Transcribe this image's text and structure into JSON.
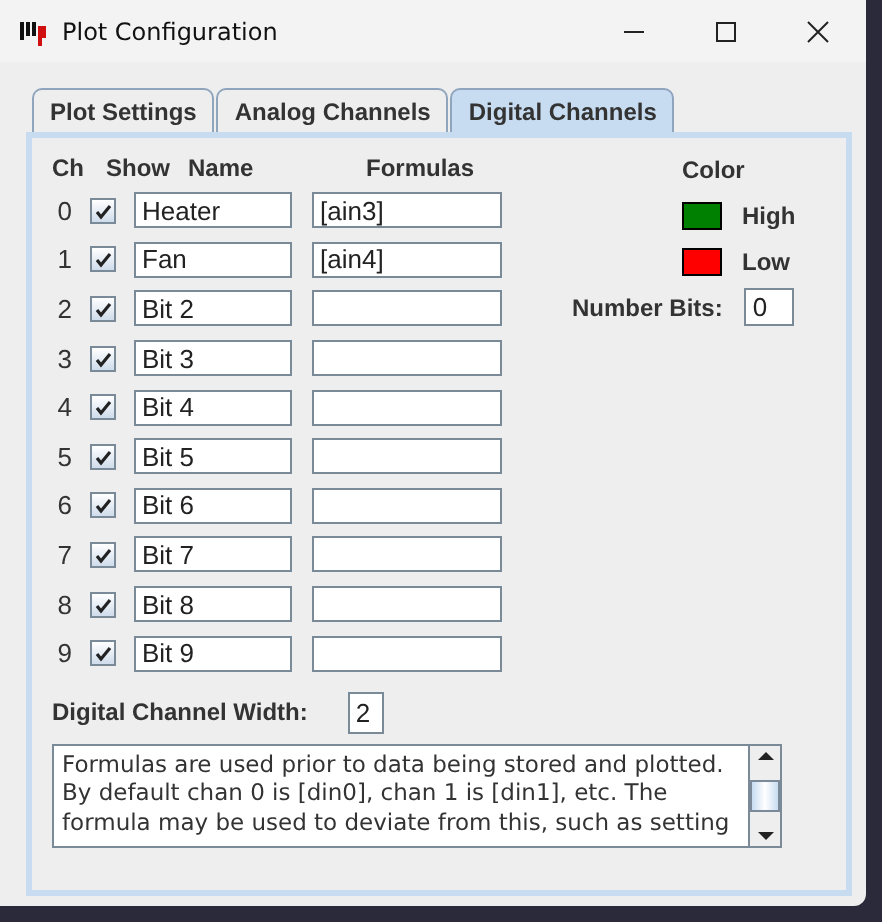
{
  "window": {
    "title": "Plot Configuration"
  },
  "tabs": [
    {
      "label": "Plot Settings",
      "selected": false
    },
    {
      "label": "Analog Channels",
      "selected": false
    },
    {
      "label": "Digital Channels",
      "selected": true
    }
  ],
  "columns": [
    "Ch",
    "Show",
    "Name",
    "Formulas"
  ],
  "channels": [
    {
      "ch": "0",
      "show": true,
      "name": "Heater",
      "formula": "[ain3]"
    },
    {
      "ch": "1",
      "show": true,
      "name": "Fan",
      "formula": "[ain4]"
    },
    {
      "ch": "2",
      "show": true,
      "name": "Bit 2"
    },
    {
      "ch": "3",
      "show": true,
      "name": "Bit 3"
    },
    {
      "ch": "4",
      "show": true,
      "name": "Bit 4"
    },
    {
      "ch": "5",
      "show": true,
      "name": "Bit 5"
    },
    {
      "ch": "6",
      "show": true,
      "name": "Bit 6"
    },
    {
      "ch": "7",
      "show": true,
      "name": "Bit 7"
    },
    {
      "ch": "8",
      "show": true,
      "name": "Bit 8"
    },
    {
      "ch": "9",
      "show": true,
      "name": "Bit 9"
    }
  ],
  "color": {
    "title": "Color",
    "items": [
      {
        "label": "High",
        "color": "#008000"
      },
      {
        "label": "Low",
        "color": "#ff0000"
      }
    ]
  },
  "number_bits": {
    "label": "Number Bits:",
    "value": "0"
  },
  "channel_width": {
    "label": "Digital Channel Width:",
    "value": "2"
  },
  "help_text": "Formulas are used prior to data being stored and plotted. By default chan 0 is [din0], chan 1 is [din1], etc. The formula may be used to deviate from this, such as setting"
}
